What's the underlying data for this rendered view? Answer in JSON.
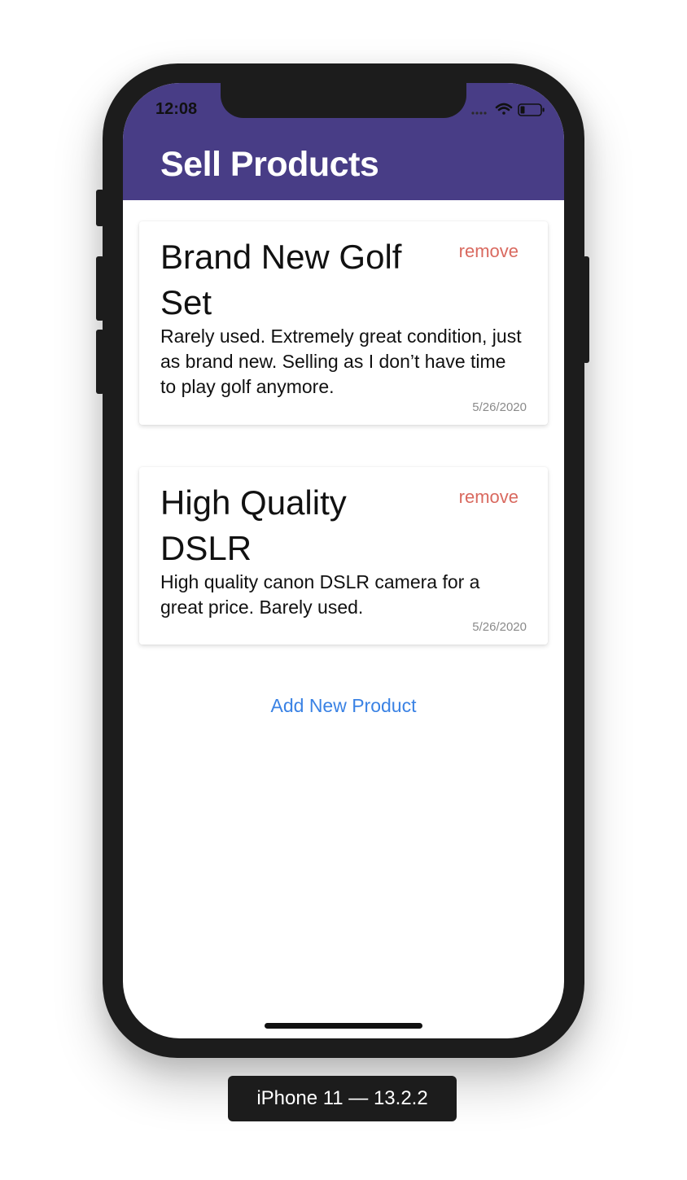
{
  "status_bar": {
    "time": "12:08",
    "icons": [
      "signal-icon",
      "wifi-icon",
      "battery-icon"
    ]
  },
  "navbar": {
    "title": "Sell Products",
    "color": "#483d86"
  },
  "products": [
    {
      "title": "Brand New Golf Set",
      "remove_label": "remove",
      "description": "Rarely used. Extremely great condition, just as brand new. Selling as I don’t have time to play golf anymore.",
      "date": "5/26/2020"
    },
    {
      "title": "High Quality DSLR",
      "remove_label": "remove",
      "description": "High quality canon DSLR camera for a great price. Barely used.",
      "date": "5/26/2020"
    }
  ],
  "add_button": {
    "label": "Add New Product",
    "color": "#3a82e4"
  },
  "remove_color": "#d9695f",
  "device_label": "iPhone 11 — 13.2.2"
}
